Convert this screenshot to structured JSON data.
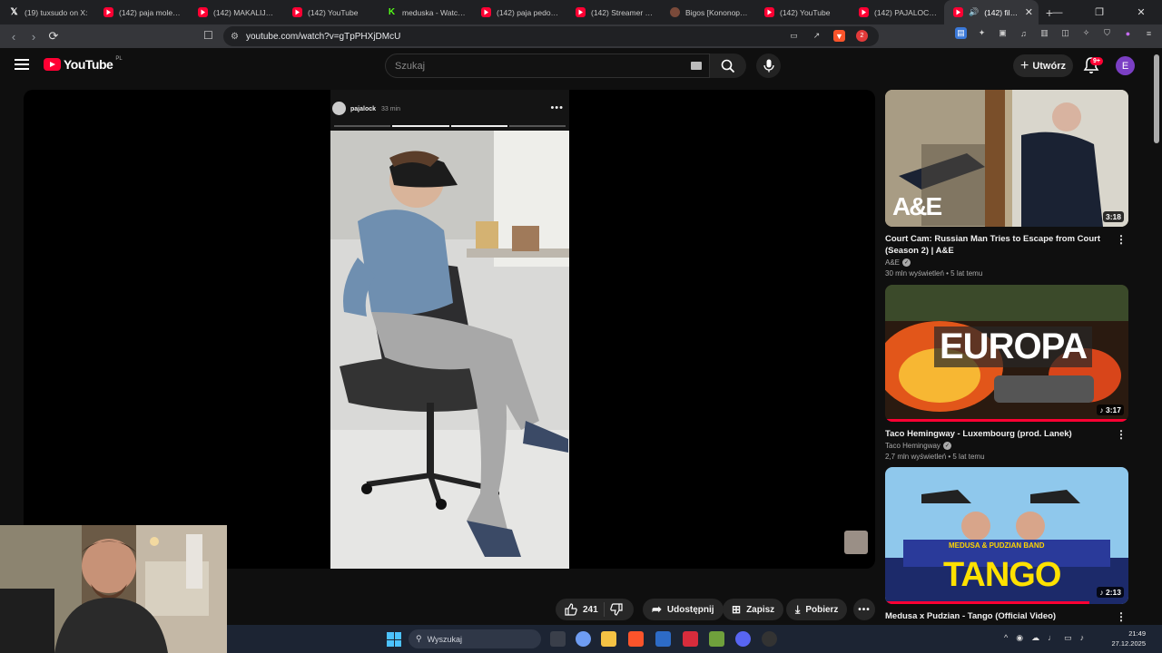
{
  "browser": {
    "tabs": [
      {
        "title": "(19) tuxsudo on X:",
        "favicon": "x"
      },
      {
        "title": "(142) paja molestuje",
        "favicon": "yt"
      },
      {
        "title": "(142) MAKALIJER TR",
        "favicon": "yt"
      },
      {
        "title": "(142) YouTube",
        "favicon": "yt"
      },
      {
        "title": "meduska - Watch c",
        "favicon": "k"
      },
      {
        "title": "(142) paja pedobea",
        "favicon": "yt"
      },
      {
        "title": "(142) Streamer odp",
        "favicon": "yt"
      },
      {
        "title": "Bigos [Kononopedia",
        "favicon": "bg"
      },
      {
        "title": "(142) YouTube",
        "favicon": "yt"
      },
      {
        "title": "(142) PAJALOCK CZ",
        "favicon": "yt"
      },
      {
        "title": "(142) filip pi",
        "favicon": "yt",
        "active": true
      }
    ],
    "new_tab": "+",
    "url": "youtube.com/watch?v=gTpPHXjDMcU",
    "ext_badge": "2"
  },
  "youtube": {
    "logo": "YouTube",
    "country": "PL",
    "search_placeholder": "Szukaj",
    "create_label": "Utwórz",
    "notif_badge": "9+",
    "avatar_letter": "E"
  },
  "short": {
    "username": "pajalock",
    "time": "33 min"
  },
  "actions": {
    "likes": "241",
    "share": "Udostępnij",
    "save": "Zapisz",
    "download": "Pobierz"
  },
  "recommendations": [
    {
      "title": "Court Cam: Russian Man Tries to Escape from Court (Season 2) | A&E",
      "channel": "A&E",
      "meta": "30 mln wyświetleń • 5 lat temu",
      "duration": "3:18",
      "thumb_text": "A&E"
    },
    {
      "title": "Taco Hemingway - Luxembourg (prod. Lanek)",
      "channel": "Taco Hemingway",
      "meta": "2,7 mln wyświetleń • 5 lat temu",
      "duration": "♪ 3:17",
      "thumb_text": "EUROPA"
    },
    {
      "title": "Medusa x Pudzian - Tango (Official Video)",
      "channel": "",
      "meta": "",
      "duration": "♪ 2:13",
      "thumb_text": "TANGO",
      "thumb_subtext": "MEDUSA & PUDZIAN BAND"
    }
  ],
  "taskbar": {
    "search_placeholder": "Wyszukaj",
    "time": "21:49",
    "date": "27.12.2025"
  }
}
